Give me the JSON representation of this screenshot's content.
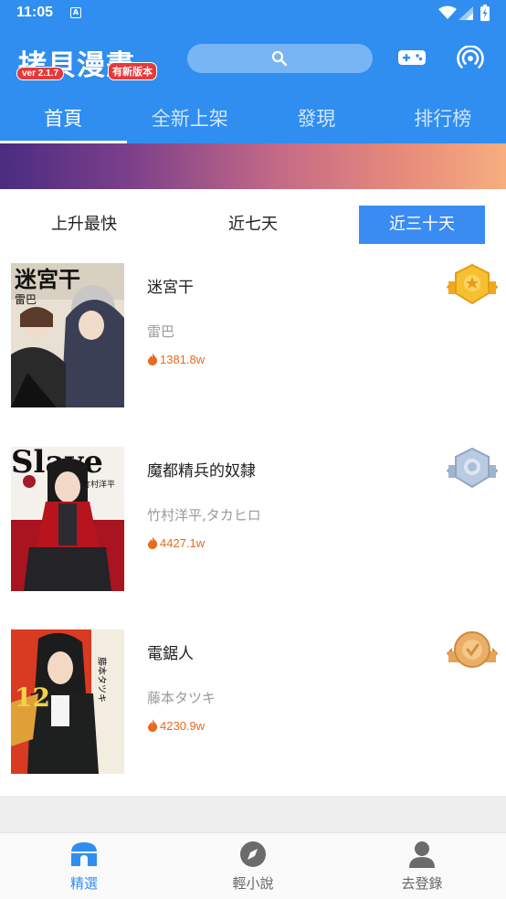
{
  "status_bar": {
    "time": "11:05",
    "notification_icon": "a-icon"
  },
  "header": {
    "logo_text": "拷貝漫畫",
    "version": "ver 2.1.7",
    "new_version_badge": "有新版本",
    "search_icon": "search-icon",
    "game_icon": "gamepad-icon",
    "broadcast_icon": "broadcast-icon"
  },
  "tabs": [
    {
      "label": "首頁",
      "active": true
    },
    {
      "label": "全新上架",
      "active": false
    },
    {
      "label": "發現",
      "active": false
    },
    {
      "label": "排行榜",
      "active": false
    }
  ],
  "period_tabs": [
    {
      "label": "上升最快",
      "active": false
    },
    {
      "label": "近七天",
      "active": false
    },
    {
      "label": "近三十天",
      "active": true
    }
  ],
  "ranking": [
    {
      "rank": 1,
      "title": "迷宮干",
      "author": "雷巴",
      "heat": "1381.8w",
      "medal": "gold"
    },
    {
      "rank": 2,
      "title": "魔都精兵的奴隸",
      "author": "竹村洋平,タカヒロ",
      "heat": "4427.1w",
      "medal": "silver"
    },
    {
      "rank": 3,
      "title": "電鋸人",
      "author": "藤本タツキ",
      "heat": "4230.9w",
      "medal": "bronze"
    }
  ],
  "covers": [
    {
      "text": "迷宮干",
      "sub": "雷巴"
    },
    {
      "text": "Slave",
      "sub": "竹村洋平"
    },
    {
      "text": "12",
      "sub": "藤本タツキ"
    }
  ],
  "bottom_nav": [
    {
      "label": "精選",
      "active": true,
      "icon": "home-icon"
    },
    {
      "label": "輕小說",
      "active": false,
      "icon": "compass-icon"
    },
    {
      "label": "去登錄",
      "active": false,
      "icon": "user-icon"
    }
  ],
  "colors": {
    "primary": "#2f8ef0",
    "heat": "#e86a1c",
    "active_period": "#3b8cf2"
  }
}
